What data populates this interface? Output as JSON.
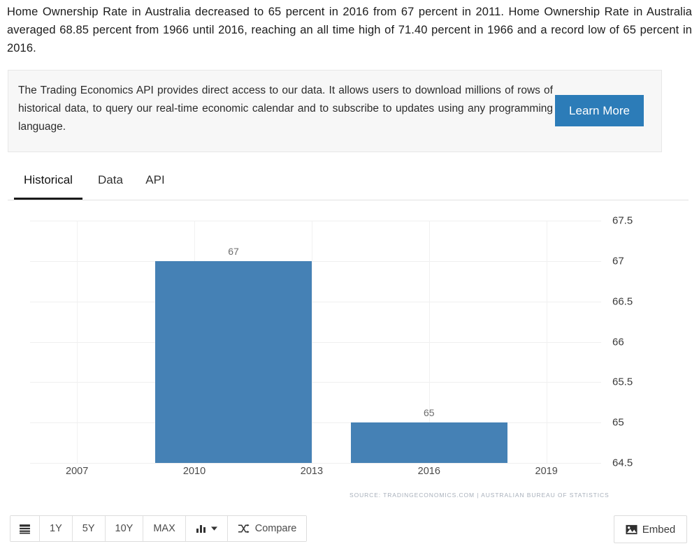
{
  "intro": {
    "paragraph": "Home Ownership Rate in Australia decreased to 65 percent in 2016 from 67 percent in 2011. Home Ownership Rate in Australia averaged 68.85 percent from 1966 until 2016, reaching an all time high of 71.40 percent in 1966 and a record low of 65 percent in 2016."
  },
  "promo": {
    "text": "The Trading Economics API provides direct access to our data. It allows users to download millions of rows of historical data, to query our real-time economic calendar and to subscribe to updates using any programming language.",
    "button_label": "Learn More",
    "button_color": "#2c7cb8"
  },
  "tabs": [
    {
      "label": "Historical",
      "active": true
    },
    {
      "label": "Data",
      "active": false
    },
    {
      "label": "API",
      "active": false
    }
  ],
  "toolbar": {
    "list_icon": "list-icon",
    "ranges": [
      "1Y",
      "5Y",
      "10Y",
      "MAX"
    ],
    "chart_type_icon": "bar-chart-icon",
    "chart_type_caret": "chevron-down-icon",
    "compare_icon": "shuffle-icon",
    "compare_label": "Compare",
    "embed_icon": "image-icon",
    "embed_label": "Embed"
  },
  "chart_data": {
    "type": "bar",
    "title": "",
    "subtitle": "",
    "xlabel": "",
    "ylabel": "",
    "categories": [
      "2011",
      "2016"
    ],
    "values": [
      67,
      65
    ],
    "value_labels": [
      "67",
      "65"
    ],
    "bar_color": "#4581b5",
    "ylim": [
      64.5,
      67.5
    ],
    "yticks": [
      "67.5",
      "67",
      "66.5",
      "66",
      "65.5",
      "65",
      "64.5"
    ],
    "ytick_values": [
      67.5,
      67,
      66.5,
      66,
      65.5,
      65,
      64.5
    ],
    "xticks": [
      "2007",
      "2010",
      "2013",
      "2016",
      "2019"
    ],
    "xtick_values": [
      2007,
      2010,
      2013,
      2016,
      2019
    ],
    "xlim": [
      2005.8,
      2020.4
    ],
    "grid": true,
    "legend": "none",
    "source": "SOURCE: TRADINGECONOMICS.COM  |  AUSTRALIAN BUREAU OF STATISTICS"
  }
}
